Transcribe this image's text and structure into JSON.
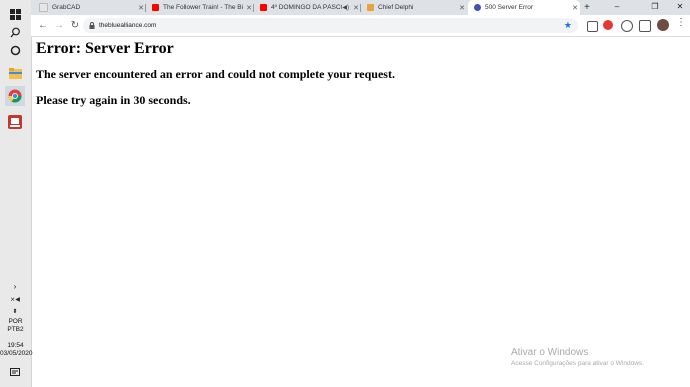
{
  "browser": {
    "tabs": [
      {
        "label": "GrabCAD",
        "icon": "grabcad-icon",
        "color": "#e6e6e6",
        "active": false
      },
      {
        "label": "The Follower Train! - The Bi",
        "icon": "youtube-icon",
        "color": "#ff0000",
        "active": false
      },
      {
        "label": "4º DOMINGO DA PÁSCO",
        "icon": "youtube-icon",
        "color": "#ff0000",
        "active": false
      },
      {
        "label": "Chief Delphi",
        "icon": "chiefdelphi-icon",
        "color": "#e8a33c",
        "active": false
      },
      {
        "label": "500 Server Error",
        "icon": "tba-icon",
        "color": "#3f51b5",
        "active": true
      }
    ],
    "new_tab": "+",
    "url": "thebluealliance.com"
  },
  "page": {
    "title": "Error: Server Error",
    "message": "The server encountered an error and could not complete your request.",
    "retry": "Please try again in 30 seconds."
  },
  "taskbar": {
    "lang1": "POR",
    "lang2": "PTB2",
    "time": "19:54",
    "date": "03/05/2020"
  },
  "watermark": {
    "line1": "Ativar o Windows",
    "line2": "Acesse Configurações para ativar o Windows."
  },
  "colors": {
    "accent_blue": "#1a73e8",
    "youtube_red": "#ff0000"
  }
}
